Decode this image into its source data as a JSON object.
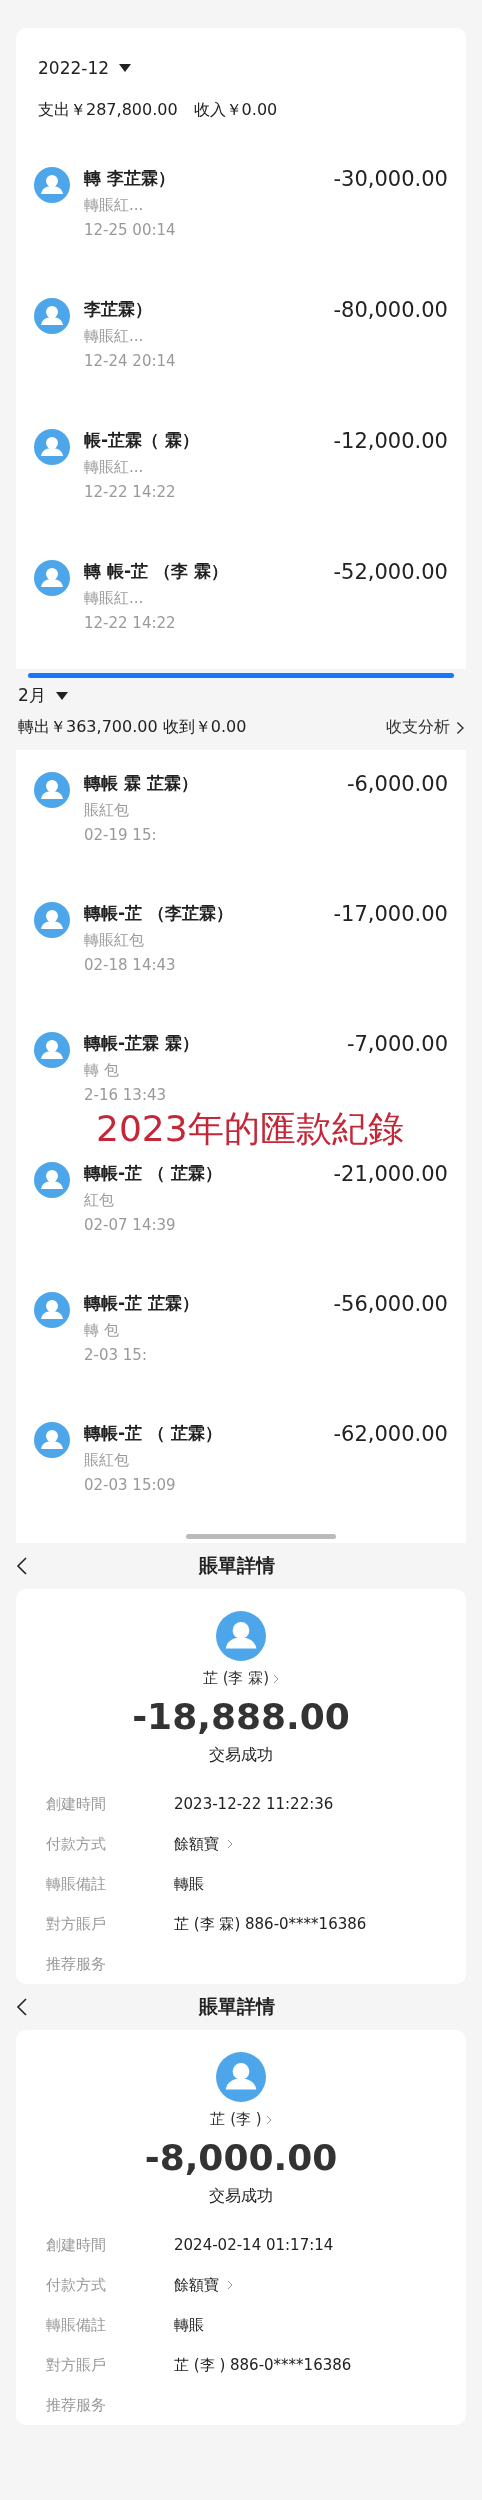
{
  "bill_list_2022": {
    "month": "2022-12",
    "summary": "支出￥287,800.00　收入￥0.00",
    "transactions": [
      {
        "title": "轉 李芷霖）",
        "note": "轉賬紅...",
        "time": "12-25 00:14",
        "amount": "-30,000.00"
      },
      {
        "title": "李芷霖）",
        "note": "轉賬紅...",
        "time": "12-24 20:14",
        "amount": "-80,000.00"
      },
      {
        "title": "帳-芷霖（ 霖）",
        "note": "轉賬紅...",
        "time": "12-22 14:22",
        "amount": "-12,000.00"
      },
      {
        "title": "轉 帳-芷 （李 霖）",
        "note": "轉賬紅...",
        "time": "12-22 14:22",
        "amount": "-52,000.00"
      }
    ]
  },
  "bill_list_2023": {
    "month": "2月",
    "summary": "轉出￥363,700.00 收到￥0.00",
    "analysis_link": "收支分析",
    "transactions": [
      {
        "title": "轉帳 霖 芷霖）",
        "note": "賬紅包",
        "time": "02-19 15:",
        "amount": "-6,000.00"
      },
      {
        "title": "轉帳-芷 （李芷霖）",
        "note": "轉賬紅包",
        "time": "02-18 14:43",
        "amount": "-17,000.00"
      },
      {
        "title": "轉帳-芷霖 霖）",
        "note": "轉 包",
        "time": "2-16 13:43",
        "amount": "-7,000.00"
      },
      {
        "title": "轉帳-芷 （ 芷霖）",
        "note": "紅包",
        "time": "02-07 14:39",
        "amount": "-21,000.00"
      },
      {
        "title": "轉帳-芷 芷霖）",
        "note": "轉 包",
        "time": "2-03 15:",
        "amount": "-56,000.00"
      },
      {
        "title": "轉帳-芷 （ 芷霖）",
        "note": "賬紅包",
        "time": "02-03 15:09",
        "amount": "-62,000.00"
      }
    ],
    "caption": "2023年的匯款紀錄"
  },
  "bill_details": [
    {
      "header": "賬單詳情",
      "name": "芷 (李 霖)",
      "amount": "-18,888.00",
      "status": "交易成功",
      "fields": [
        {
          "label": "創建時間",
          "value": "2023-12-22  11:22:36",
          "link": false
        },
        {
          "label": "付款方式",
          "value": "餘額寶",
          "link": true
        },
        {
          "label": "轉賬備註",
          "value": "轉賬",
          "link": false
        },
        {
          "label": "對方賬戶",
          "value": "芷 (李 霖) 886-0****16386",
          "link": false
        },
        {
          "label": "推荐服务",
          "link": false
        }
      ]
    },
    {
      "header": "賬單詳情",
      "name": "芷 (李 )",
      "amount": "-8,000.00",
      "status": "交易成功",
      "fields": [
        {
          "label": "創建時間",
          "value": "2024-02-14  01:17:14",
          "link": false
        },
        {
          "label": "付款方式",
          "value": "餘額寶",
          "link": true
        },
        {
          "label": "轉賬備註",
          "value": "轉賬",
          "link": false
        },
        {
          "label": "對方賬戶",
          "value": "芷 (李 ) 886-0****16386",
          "link": false
        },
        {
          "label": "推荐服务",
          "link": false
        }
      ]
    }
  ]
}
